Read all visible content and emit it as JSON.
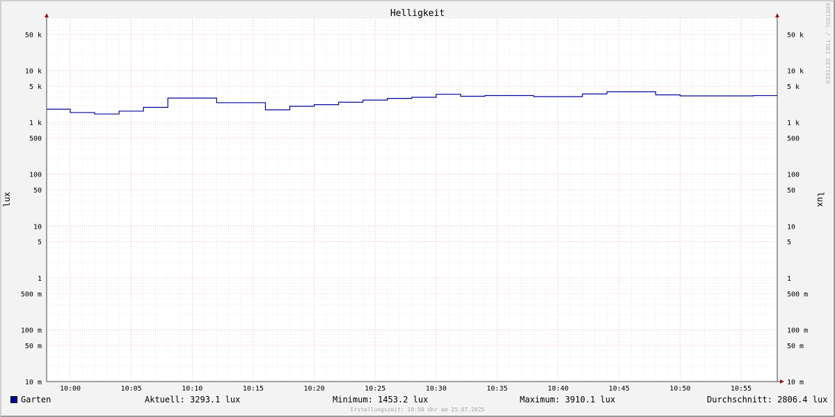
{
  "chart_data": {
    "type": "line",
    "title": "Helligkeit",
    "ylabel": "lux",
    "yscale": "log",
    "ylim": [
      0.01,
      100000
    ],
    "x_ticks": [
      "10:00",
      "10:05",
      "10:10",
      "10:15",
      "10:20",
      "10:25",
      "10:30",
      "10:35",
      "10:40",
      "10:45",
      "10:50",
      "10:55"
    ],
    "y_ticks": [
      {
        "v": 50000,
        "label": "50 k"
      },
      {
        "v": 10000,
        "label": "10 k"
      },
      {
        "v": 5000,
        "label": "5 k"
      },
      {
        "v": 1000,
        "label": "1 k"
      },
      {
        "v": 500,
        "label": "500"
      },
      {
        "v": 100,
        "label": "100"
      },
      {
        "v": 50,
        "label": "50"
      },
      {
        "v": 10,
        "label": "10"
      },
      {
        "v": 5,
        "label": "5"
      },
      {
        "v": 1,
        "label": "1"
      },
      {
        "v": 0.5,
        "label": "500 m"
      },
      {
        "v": 0.1,
        "label": "100 m"
      },
      {
        "v": 0.05,
        "label": "50 m"
      },
      {
        "v": 0.01,
        "label": "10 m"
      }
    ],
    "series": [
      {
        "name": "Garten",
        "color": "#00009e",
        "x": [
          "09:58",
          "10:00",
          "10:02",
          "10:04",
          "10:06",
          "10:08",
          "10:12",
          "10:16",
          "10:18",
          "10:20",
          "10:22",
          "10:24",
          "10:26",
          "10:28",
          "10:30",
          "10:32",
          "10:34",
          "10:38",
          "10:42",
          "10:44",
          "10:48",
          "10:50",
          "10:56"
        ],
        "y": [
          1800,
          1550,
          1453.2,
          1650,
          1950,
          2950,
          2400,
          1750,
          2050,
          2200,
          2450,
          2700,
          2900,
          3050,
          3500,
          3200,
          3300,
          3150,
          3550,
          3910.1,
          3400,
          3250,
          3293.1
        ]
      }
    ],
    "grid": true
  },
  "legend": {
    "series_name": "Garten",
    "current": "Aktuell: 3293.1 lux",
    "minimum": "Minimum: 1453.2 lux",
    "maximum": "Maximum: 3910.1 lux",
    "average": "Durchschnitt: 2806.4 lux"
  },
  "footer": "Erstellungszeit: 10:58 Uhr am 25.07.2025",
  "watermark": "RRDTOOL / TOBI OETIKER"
}
